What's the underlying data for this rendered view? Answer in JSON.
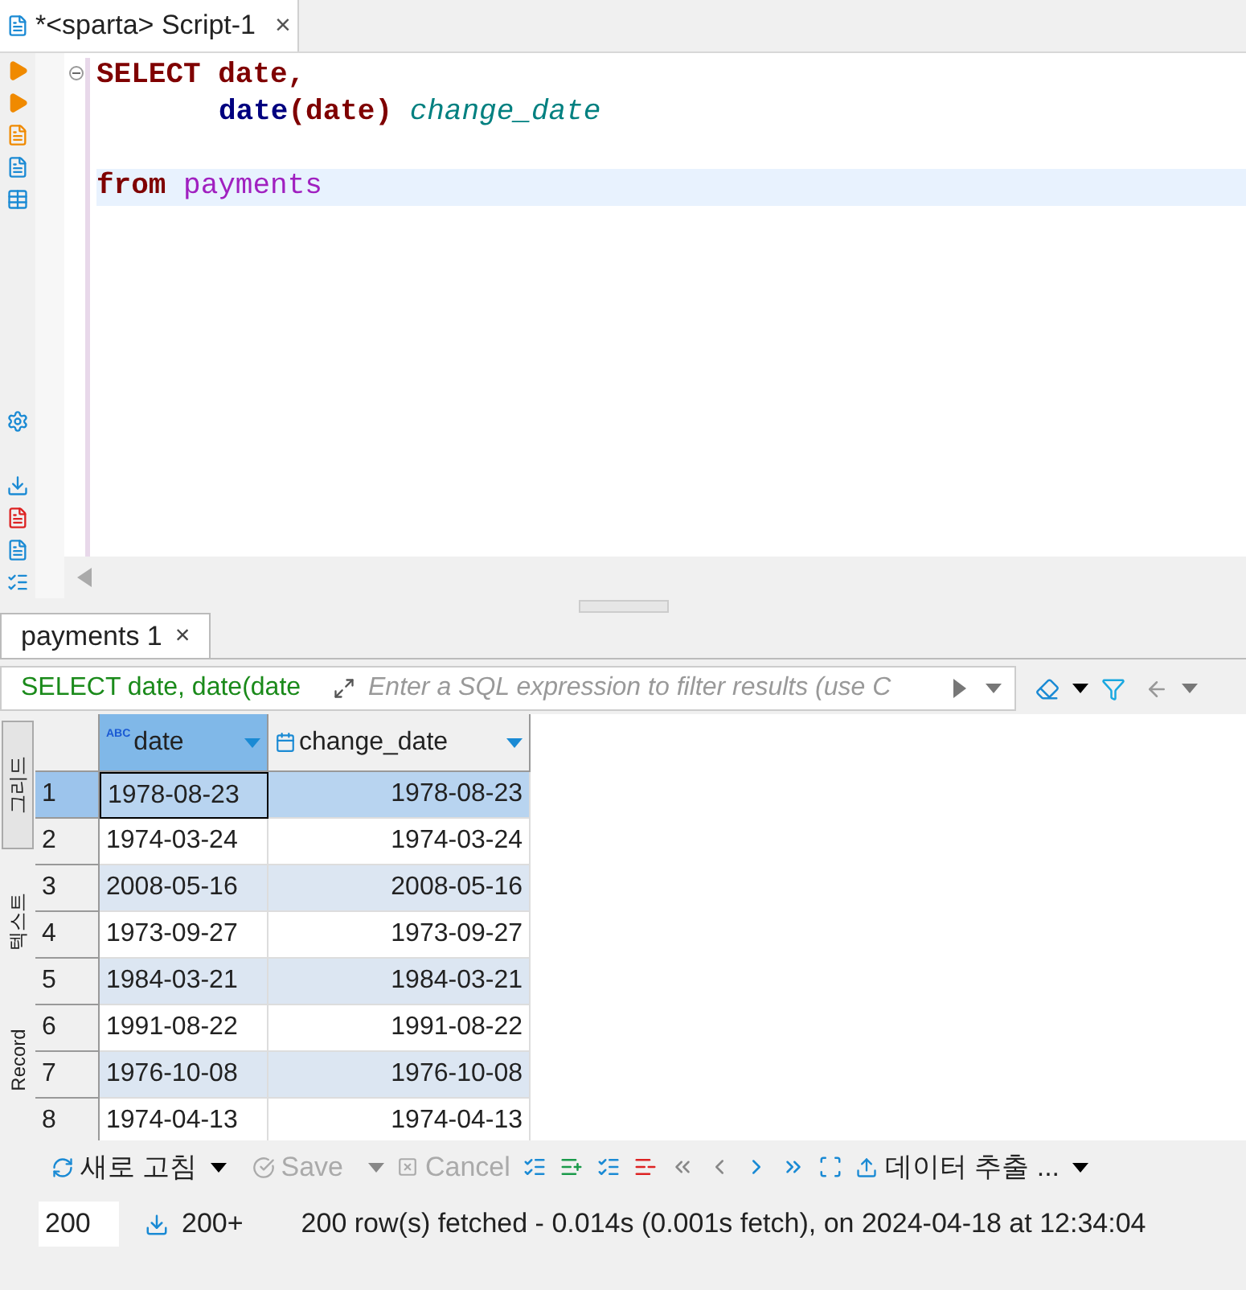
{
  "editor_tab": {
    "title": "*<sparta> Script-1",
    "close": "×"
  },
  "code_lines": [
    {
      "current": false,
      "indented": false,
      "blank_line_before": false,
      "tokens": [
        {
          "kind": "keyword",
          "text": "SELECT"
        },
        {
          "kind": "column",
          "text": " date,"
        }
      ]
    },
    {
      "current": false,
      "indented": true,
      "blank_line_before": false,
      "tokens": [
        {
          "kind": "function",
          "text": "date"
        },
        {
          "kind": "column",
          "text": "(date)"
        },
        {
          "kind": "alias",
          "text": " change_date"
        }
      ]
    },
    {
      "current": true,
      "indented": false,
      "blank_line_before": true,
      "tokens": [
        {
          "kind": "keyword",
          "text": "from"
        },
        {
          "kind": "table",
          "text": " payments"
        }
      ]
    }
  ],
  "results_tab": {
    "title": "payments 1",
    "close": "×"
  },
  "filter": {
    "query": "SELECT date, date(date",
    "placeholder": "Enter a SQL expression to filter results (use C"
  },
  "side_tabs": [
    {
      "label": "그리드",
      "selected": true
    },
    {
      "label": "텍스트",
      "selected": false
    },
    {
      "label": "Record",
      "selected": false
    }
  ],
  "columns": [
    {
      "name": "date",
      "kind": "text",
      "type_label": "ABC",
      "selected": true
    },
    {
      "name": "change_date",
      "kind": "date",
      "selected": false
    }
  ],
  "rows": [
    {
      "number": "1",
      "date": "1978-08-23",
      "change_date": "1978-08-23",
      "selected": true
    },
    {
      "number": "2",
      "date": "1974-03-24",
      "change_date": "1974-03-24",
      "selected": false
    },
    {
      "number": "3",
      "date": "2008-05-16",
      "change_date": "2008-05-16",
      "selected": false
    },
    {
      "number": "4",
      "date": "1973-09-27",
      "change_date": "1973-09-27",
      "selected": false
    },
    {
      "number": "5",
      "date": "1984-03-21",
      "change_date": "1984-03-21",
      "selected": false
    },
    {
      "number": "6",
      "date": "1991-08-22",
      "change_date": "1991-08-22",
      "selected": false
    },
    {
      "number": "7",
      "date": "1976-10-08",
      "change_date": "1976-10-08",
      "selected": false
    },
    {
      "number": "8",
      "date": "1974-04-13",
      "change_date": "1974-04-13",
      "selected": false
    }
  ],
  "toolbar": {
    "refresh": "새로 고침",
    "save": {
      "label": "Save",
      "disabled": true
    },
    "cancel": {
      "label": "Cancel",
      "disabled": true
    },
    "export": "데이터 추출 ..."
  },
  "status": {
    "fetch_size": "200",
    "fetch_all": "200+",
    "message": "200 row(s) fetched - 0.014s (0.001s fetch), on 2024-04-18 at 12:34:04"
  }
}
